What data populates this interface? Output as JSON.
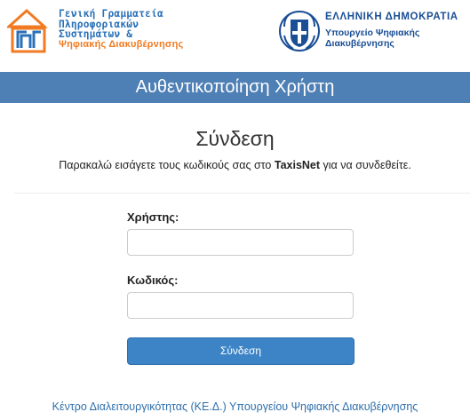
{
  "header": {
    "gsis_logo": {
      "lines": [
        "Γενική Γραμματεία",
        "Πληροφοριακών",
        "Συστημάτων &",
        "Ψηφιακής Διακυβέρνησης"
      ],
      "colors": {
        "blue": "#2a71b8",
        "orange": "#f07b22"
      }
    },
    "gov_logo": {
      "title": "ΕΛΛΗΝΙΚΗ ΔΗΜΟΚΡΑΤΙΑ",
      "ministry_line1": "Υπουργείο Ψηφιακής",
      "ministry_line2": "Διακυβέρνησης",
      "color": "#1a4e95"
    }
  },
  "title_bar": {
    "text": "Αυθεντικοποίηση Χρήστη",
    "color": "#4e7fb5"
  },
  "login": {
    "heading": "Σύνδεση",
    "subtitle_before": "Παρακαλώ εισάγετε τους κωδικούς σας στο ",
    "subtitle_bold": "TaxisNet",
    "subtitle_after": " για να συνδεθείτε.",
    "username_label": "Χρήστης:",
    "username_value": "",
    "password_label": "Κωδικός:",
    "password_value": "",
    "submit_label": "Σύνδεση",
    "button_color": "#3d84c6"
  },
  "footer": {
    "link_text": "Κέντρο Διαλειτουργικότητας (ΚΕ.Δ.) Υπουργείου Ψηφιακής Διακυβέρνησης"
  }
}
